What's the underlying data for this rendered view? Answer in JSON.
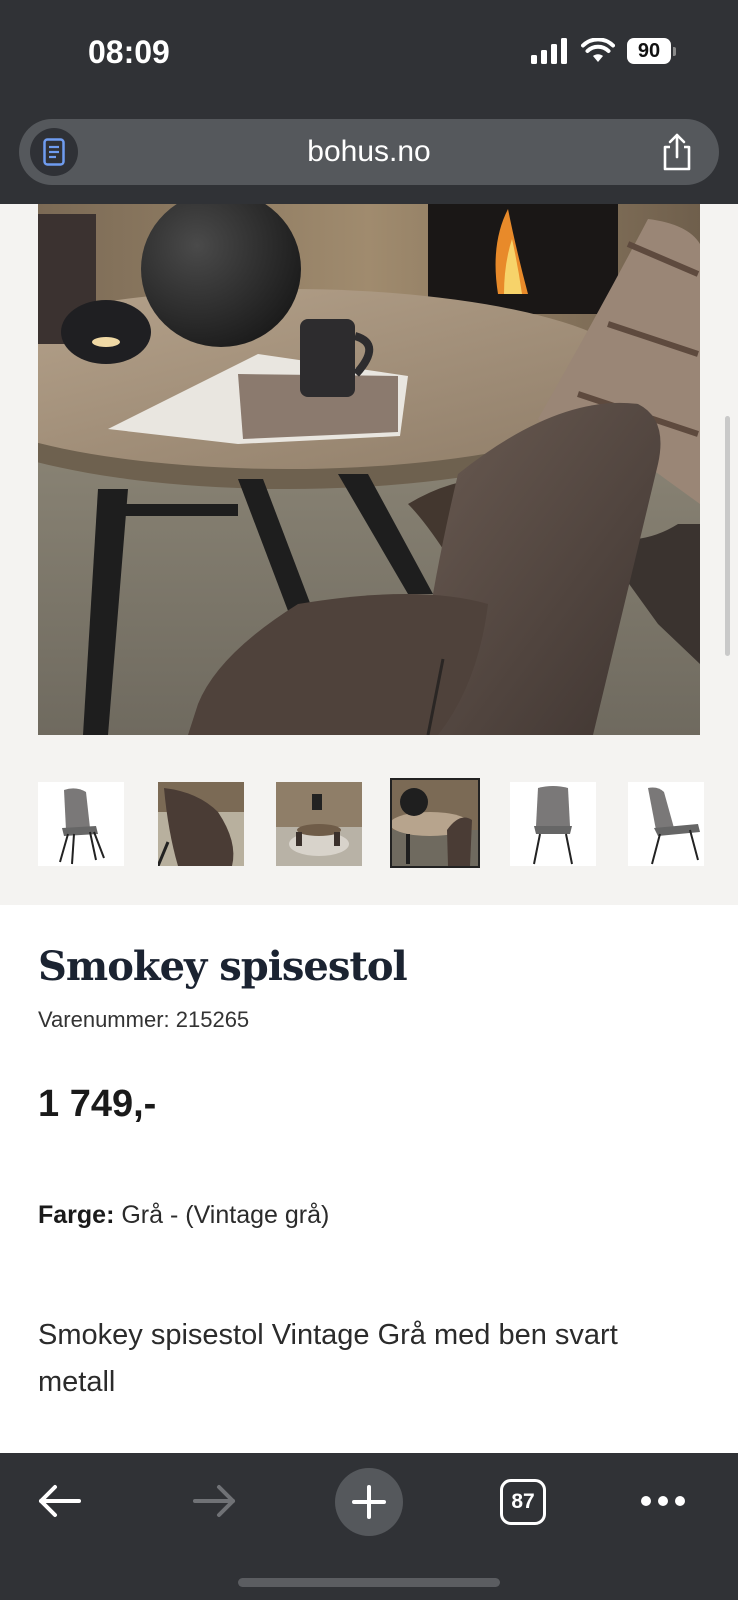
{
  "status_bar": {
    "time": "08:09",
    "battery": "90"
  },
  "browser": {
    "url": "bohus.no",
    "tab_count": "87"
  },
  "product": {
    "title": "Smokey spisestol",
    "sku": "Varenummer: 215265",
    "price": "1 749,-",
    "color_label": "Farge:",
    "color_value": "Grå - (Vintage grå)",
    "description": "Smokey spisestol Vintage Grå med ben svart metall"
  },
  "gallery": {
    "thumbnail_count": 6,
    "active_index": 3
  },
  "colors": {
    "chrome": "#303236",
    "urlbar": "#55585c",
    "gallery_bg": "#f4f3f1",
    "title": "#1b2331"
  }
}
